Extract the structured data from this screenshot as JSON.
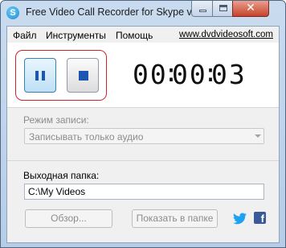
{
  "window": {
    "title": "Free Video Call Recorder for Skype v...",
    "icon": "skype-icon",
    "close_glyph": "✕"
  },
  "menu": {
    "items": [
      "Файл",
      "Инструменты",
      "Помощь"
    ],
    "site_link": "www.dvdvideosoft.com"
  },
  "recorder": {
    "pause_icon": "pause-icon",
    "stop_icon": "stop-icon",
    "timer": {
      "hours": "00",
      "minutes": "00",
      "seconds": "03",
      "separator": ":"
    }
  },
  "recording_mode": {
    "label": "Режим записи:",
    "selected": "Записывать только аудио"
  },
  "output_folder": {
    "label": "Выходная папка:",
    "value": "C:\\My Videos"
  },
  "buttons": {
    "browse": "Обзор...",
    "show_in_folder": "Показать в папке"
  },
  "social": {
    "twitter": "twitter-icon",
    "facebook": "facebook-icon",
    "facebook_glyph": "f"
  },
  "colors": {
    "accent_red": "#d1222a",
    "control_blue": "#1c56b0",
    "facebook_blue": "#3b5998",
    "twitter_blue": "#1da1f2"
  }
}
